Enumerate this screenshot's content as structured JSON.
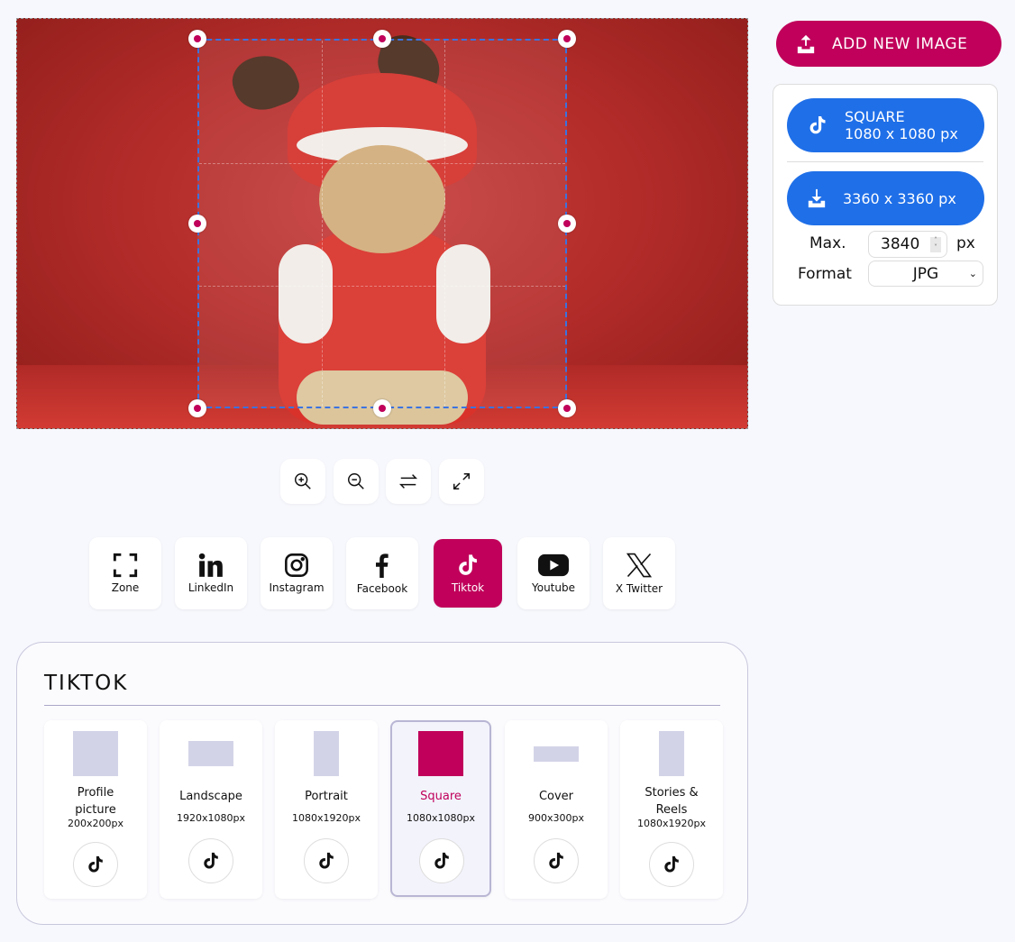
{
  "colors": {
    "accent": "#c0005a",
    "primary": "#1f6fe8",
    "shape": "#d3d3e8"
  },
  "toolbar": [
    {
      "icon": "zoom-in-icon"
    },
    {
      "icon": "zoom-out-icon"
    },
    {
      "icon": "swap-icon"
    },
    {
      "icon": "expand-icon"
    }
  ],
  "networks": [
    {
      "label": "Zone",
      "icon": "zone-icon"
    },
    {
      "label": "LinkedIn",
      "icon": "linkedin-icon"
    },
    {
      "label": "Instagram",
      "icon": "instagram-icon"
    },
    {
      "label": "Facebook",
      "icon": "facebook-icon"
    },
    {
      "label": "Tiktok",
      "icon": "tiktok-icon",
      "active": true
    },
    {
      "label": "Youtube",
      "icon": "youtube-icon"
    },
    {
      "label": "X Twitter",
      "icon": "x-icon"
    }
  ],
  "panel": {
    "title": "TIKTOK",
    "formats": [
      {
        "name": "Profile picture",
        "size": "200x200px"
      },
      {
        "name": "Landscape",
        "size": "1920x1080px"
      },
      {
        "name": "Portrait",
        "size": "1080x1920px"
      },
      {
        "name": "Square",
        "size": "1080x1080px",
        "selected": true
      },
      {
        "name": "Cover",
        "size": "900x300px"
      },
      {
        "name": "Stories & Reels",
        "size": "1080x1920px"
      }
    ]
  },
  "sidebar": {
    "add_image": "ADD NEW IMAGE",
    "format_name": "SQUARE",
    "format_size": "1080 x 1080 px",
    "download": "3360 x 3360 px",
    "max_label": "Max.",
    "max_value": "3840",
    "max_unit": "px",
    "format_label": "Format",
    "format_value": "JPG"
  }
}
